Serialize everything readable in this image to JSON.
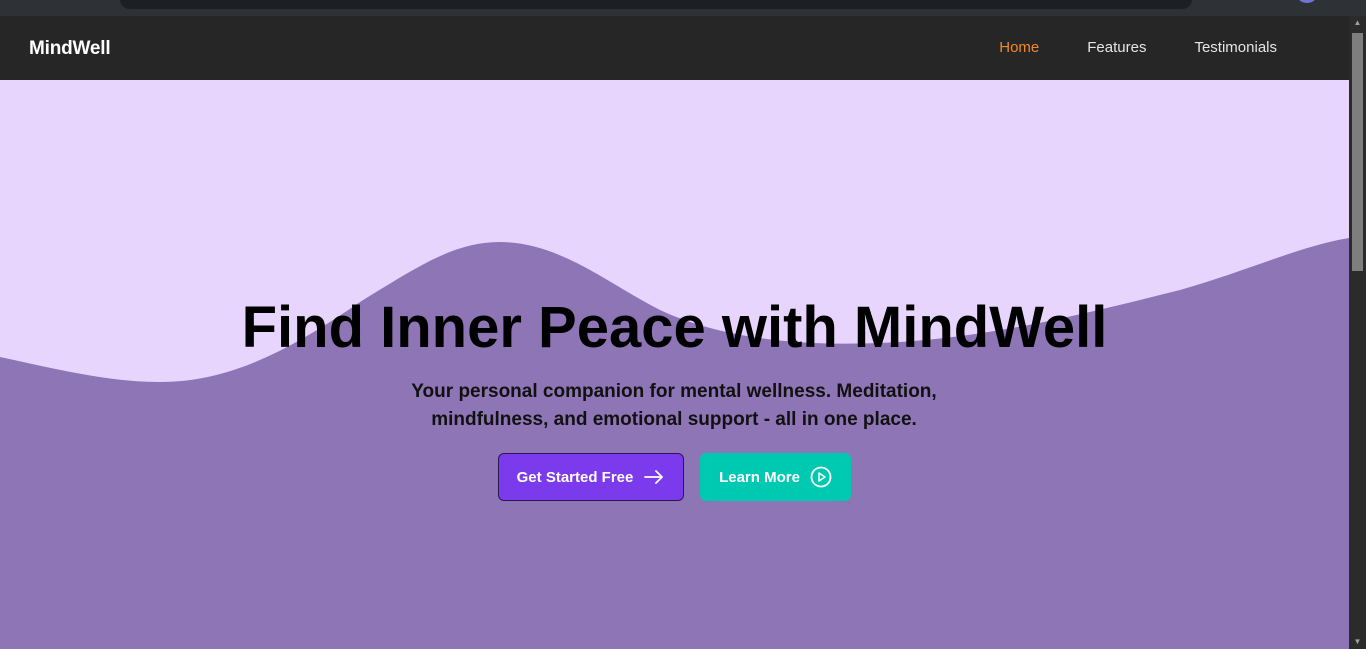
{
  "nav": {
    "brand": "MindWell",
    "links": [
      {
        "label": "Home",
        "active": true
      },
      {
        "label": "Features",
        "active": false
      },
      {
        "label": "Testimonials",
        "active": false
      }
    ]
  },
  "hero": {
    "title": "Find Inner Peace with MindWell",
    "subtitle": "Your personal companion for mental wellness. Meditation, mindfulness, and emotional support - all in one place.",
    "primary_cta": {
      "label": "Get Started Free",
      "icon": "arrow-right-icon"
    },
    "secondary_cta": {
      "label": "Learn More",
      "icon": "play-circle-icon"
    }
  },
  "colors": {
    "navbar_bg": "#262626",
    "active_link": "#f08a24",
    "hero_bg_light": "#e8d5fd",
    "hero_wave": "#8e75b6",
    "primary_button": "#7c3aed",
    "secondary_button": "#00c9b1"
  }
}
